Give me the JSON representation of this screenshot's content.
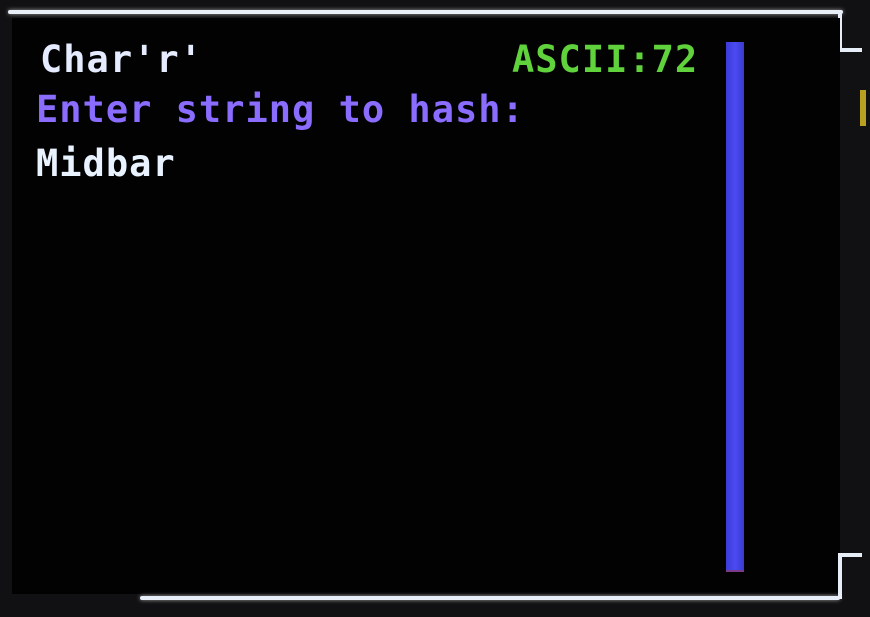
{
  "screen": {
    "char_label": "Char'r'",
    "ascii_label": "ASCII:72",
    "prompt": "Enter string to hash:",
    "input_value": "Midbar"
  },
  "colors": {
    "char_label": "#e6ecff",
    "ascii_label": "#5fd23c",
    "prompt": "#8a6cff",
    "input_value": "#e9f3ff",
    "scrollbar": "#4545e8",
    "background": "#020203"
  }
}
